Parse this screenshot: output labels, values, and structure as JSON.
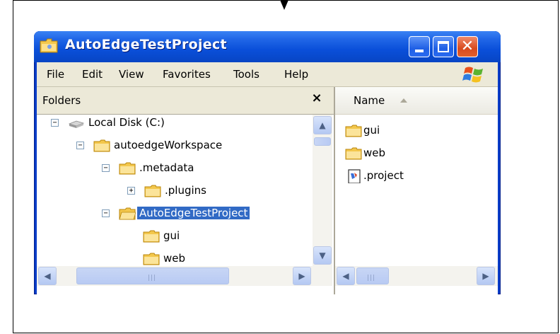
{
  "window": {
    "title": "AutoEdgeTestProject",
    "minimize_icon": "minimize-icon",
    "maximize_icon": "maximize-icon",
    "close_glyph": "✕"
  },
  "menu": [
    {
      "label": "File"
    },
    {
      "label": "Edit"
    },
    {
      "label": "View"
    },
    {
      "label": "Favorites"
    },
    {
      "label": "Tools"
    },
    {
      "label": "Help"
    }
  ],
  "folders_pane": {
    "title": "Folders",
    "close_glyph": "×",
    "tree": [
      {
        "label": "Local Disk (C:)",
        "icon": "drive-icon",
        "expander": "−",
        "selected": false
      },
      {
        "label": "autoedgeWorkspace",
        "icon": "folder-icon",
        "expander": "−",
        "selected": false
      },
      {
        "label": ".metadata",
        "icon": "folder-icon",
        "expander": "−",
        "selected": false
      },
      {
        "label": ".plugins",
        "icon": "folder-icon",
        "expander": "+",
        "selected": false
      },
      {
        "label": "AutoEdgeTestProject",
        "icon": "folder-open-icon",
        "expander": "−",
        "selected": true
      },
      {
        "label": "gui",
        "icon": "folder-icon",
        "expander": "",
        "selected": false
      },
      {
        "label": "web",
        "icon": "folder-icon",
        "expander": "",
        "selected": false
      }
    ]
  },
  "list_pane": {
    "column_name": "Name",
    "items": [
      {
        "label": "gui",
        "icon": "folder-icon"
      },
      {
        "label": "web",
        "icon": "folder-icon"
      },
      {
        "label": ".project",
        "icon": "file-icon"
      }
    ]
  },
  "scroll": {
    "up_arrow": "▲",
    "down_arrow": "▼",
    "left_arrow": "◀",
    "right_arrow": "▶",
    "grip": "|||"
  },
  "colors": {
    "titlebar": "#0a4fd9",
    "selection": "#316ac5",
    "folder": "#f3c74c"
  }
}
